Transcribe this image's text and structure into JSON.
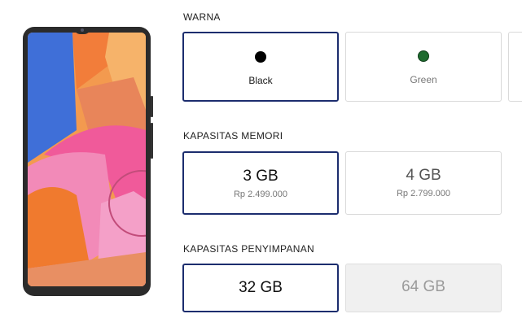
{
  "product": {
    "image_alt": "Galaxy phone"
  },
  "color": {
    "label": "WARNA",
    "options": [
      {
        "name": "Black",
        "swatch": "#000000",
        "state": "selected"
      },
      {
        "name": "Green",
        "swatch": "#1f6b2f",
        "state": "available"
      },
      {
        "name": "",
        "swatch": "",
        "state": "available"
      }
    ]
  },
  "memory": {
    "label": "KAPASITAS MEMORI",
    "options": [
      {
        "size": "3 GB",
        "price": "Rp 2.499.000",
        "state": "selected"
      },
      {
        "size": "4 GB",
        "price": "Rp 2.799.000",
        "state": "available"
      }
    ]
  },
  "storage": {
    "label": "KAPASITAS PENYIMPANAN",
    "options": [
      {
        "size": "32 GB",
        "state": "selected"
      },
      {
        "size": "64 GB",
        "state": "disabled"
      }
    ]
  },
  "colors": {
    "selected_border": "#1c2d6e",
    "muted_text": "#777777",
    "disabled_bg": "#f0f0f0"
  }
}
